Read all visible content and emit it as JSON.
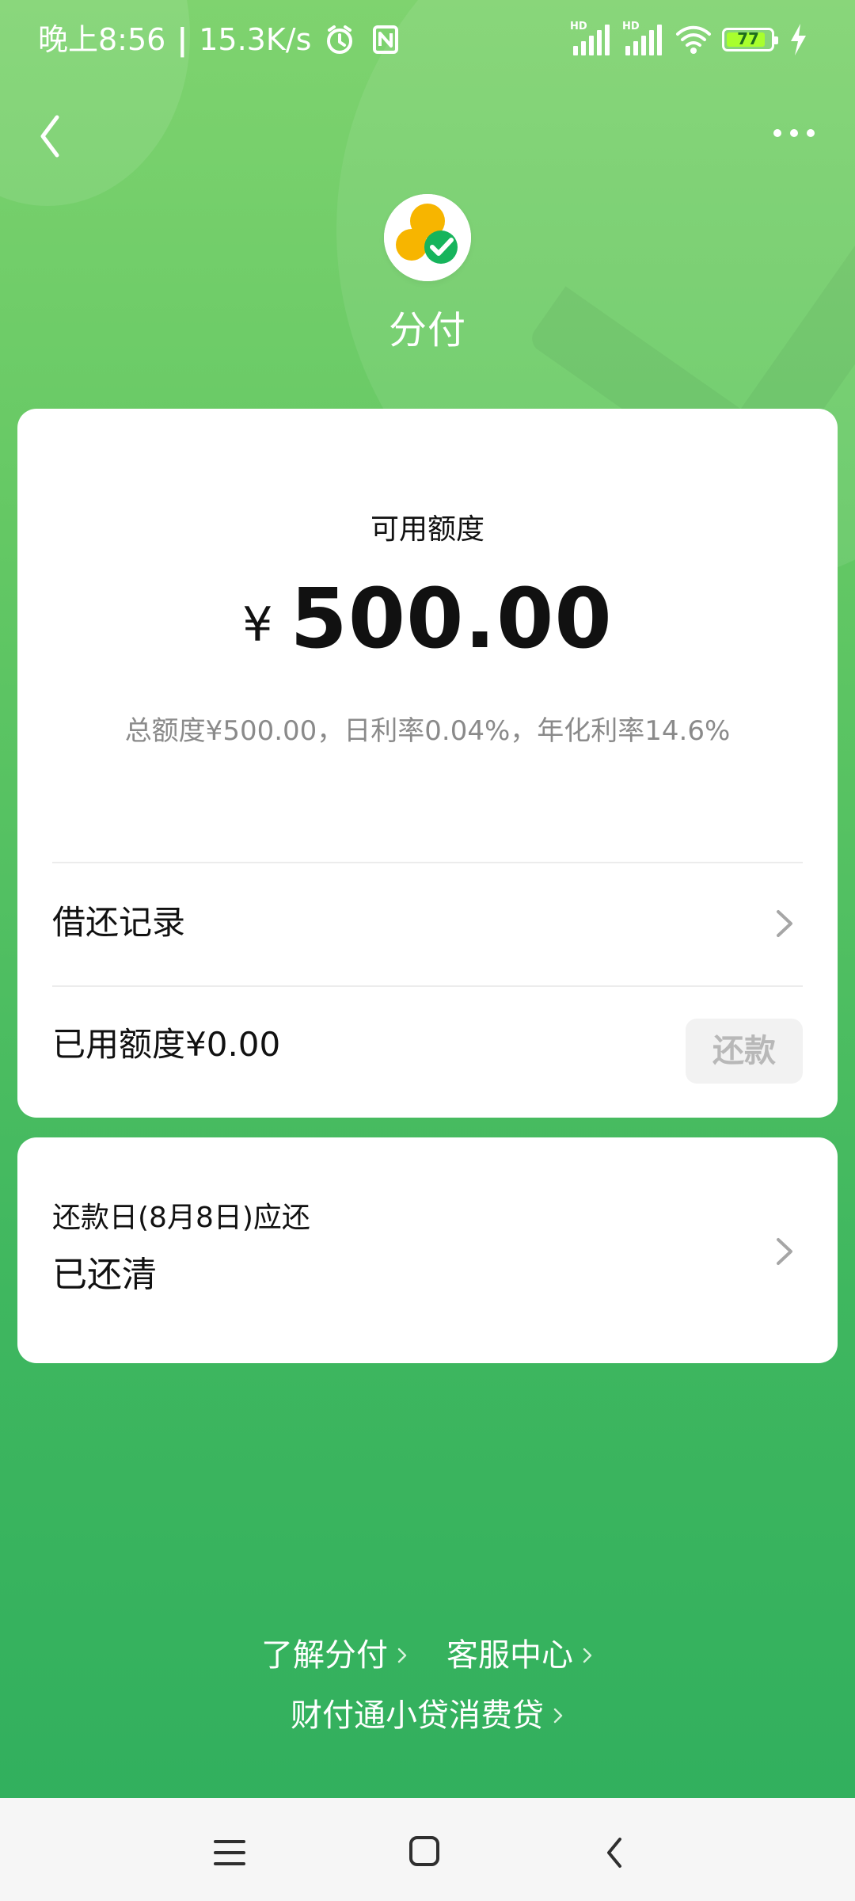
{
  "status_bar": {
    "time": "晚上8:56",
    "separator": "|",
    "speed": "15.3K/s",
    "battery_level": "77",
    "icons": [
      "alarm-icon",
      "nfc-icon",
      "signal-icon",
      "signal-icon",
      "wifi-icon",
      "battery-icon",
      "charging-icon"
    ]
  },
  "header": {
    "title": "分付",
    "back_icon": "chevron-left-icon",
    "more_icon": "more-horizontal-icon",
    "logo_icon": "fenfu-logo-icon"
  },
  "credit_card": {
    "label": "可用额度",
    "currency": "¥",
    "amount": "500.00",
    "description": "总额度¥500.00，日利率0.04%，年化利率14.6%",
    "record_label": "借还记录",
    "used_label": "已用额度¥0.00",
    "repay_button": "还款"
  },
  "repay_card": {
    "date_label": "还款日(8月8日)应还",
    "status": "已还清"
  },
  "footer": {
    "links": [
      "了解分付",
      "客服中心",
      "财付通小贷消费贷"
    ]
  },
  "system_nav": {
    "menu_icon": "menu-icon",
    "home_icon": "home-square-icon",
    "back_icon": "back-icon"
  },
  "colors": {
    "brand_green": "#5fc764",
    "gradient_top": "#7fd36f",
    "gradient_bottom": "#2fae5d",
    "card_white": "#ffffff",
    "secondary_text": "#8a8a8a",
    "disabled_button_bg": "#f2f2f2",
    "disabled_button_text": "#b8b8b8",
    "logo_yellow": "#f7b500",
    "logo_green": "#16b45c"
  }
}
